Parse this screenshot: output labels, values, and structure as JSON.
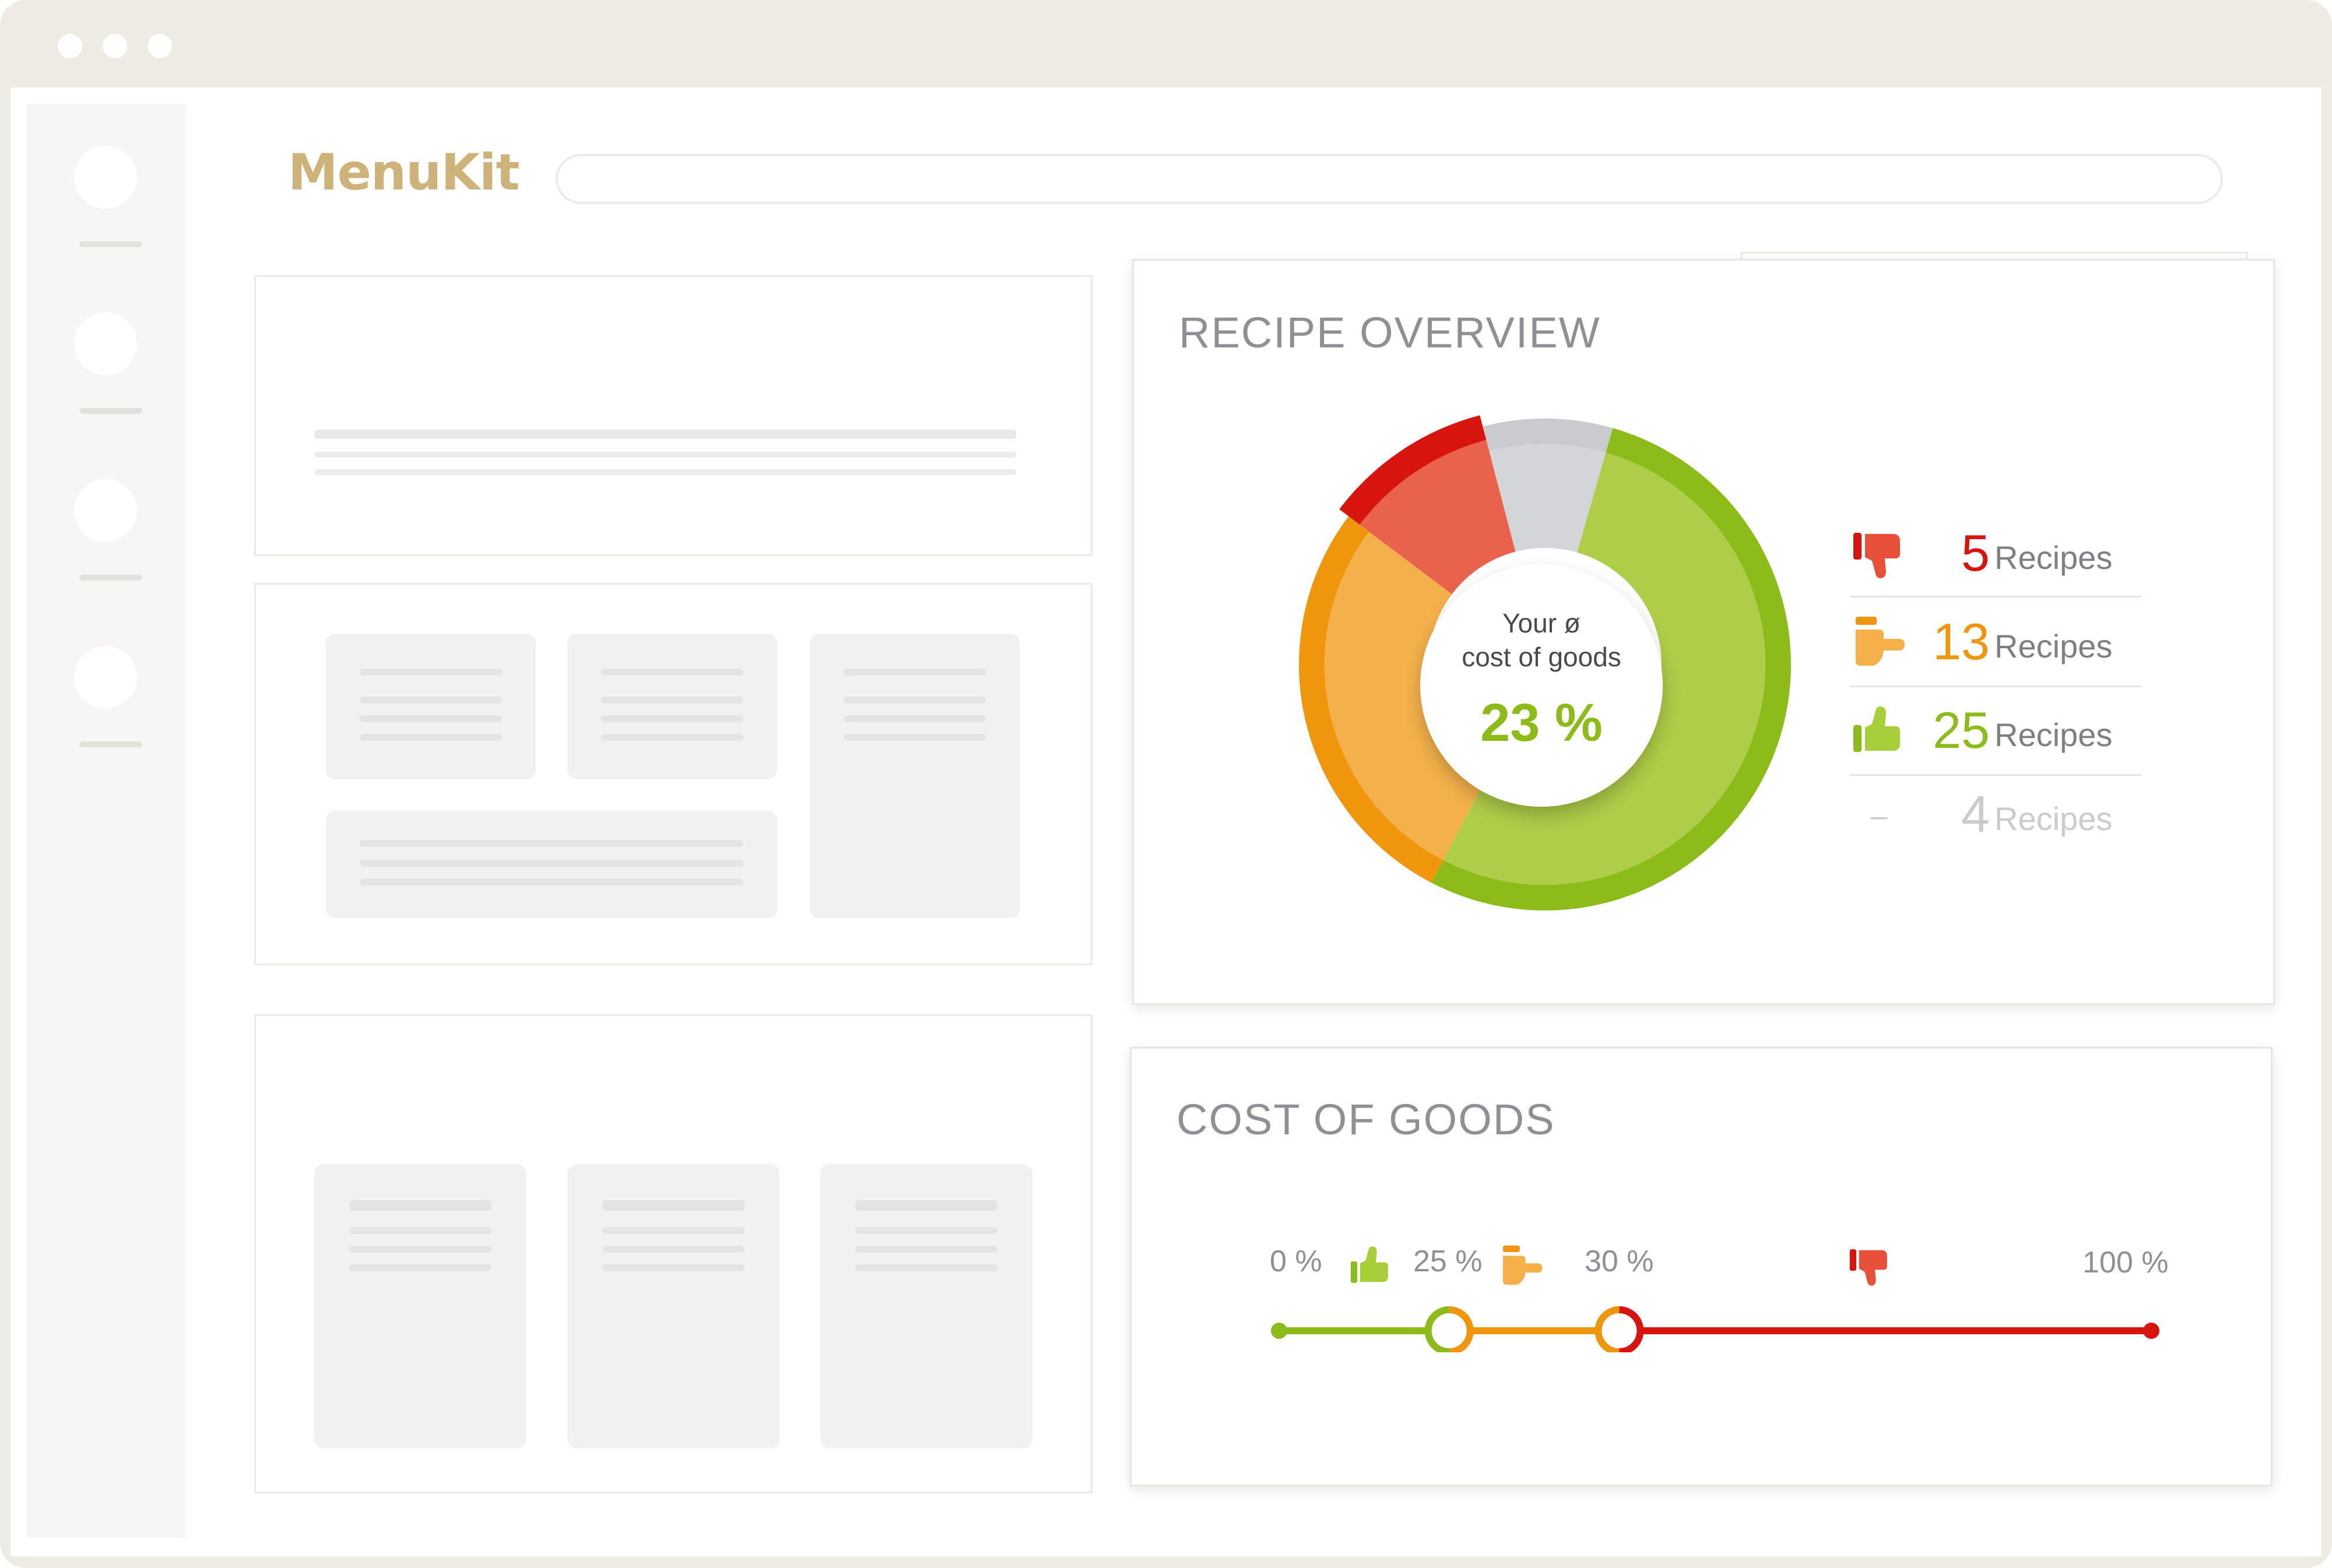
{
  "app": {
    "logo_text": "MenuKit",
    "search": {
      "placeholder": "",
      "value": ""
    }
  },
  "colors": {
    "accent": "#cdb27a",
    "red": "#d7150e",
    "orange": "#f0960d",
    "green": "#8dbb1a",
    "gray": "#c9cbcf"
  },
  "recipe_overview": {
    "title": "RECIPE OVERVIEW",
    "center_label_line1": "Your ø",
    "center_label_line2": "cost of goods",
    "center_value": "23 %",
    "legend": [
      {
        "icon": "thumbs-down-icon",
        "count": "5",
        "label": "Recipes",
        "color": "#d7150e"
      },
      {
        "icon": "thumbs-side-icon",
        "count": "13",
        "label": "Recipes",
        "color": "#f0960d"
      },
      {
        "icon": "thumbs-up-icon",
        "count": "25",
        "label": "Recipes",
        "color": "#8dbb1a"
      },
      {
        "icon": "dash-icon",
        "dash": "–",
        "count": "4",
        "label": "Recipes",
        "color": "#c9cbcf"
      }
    ]
  },
  "chart_data": {
    "type": "pie",
    "title": "RECIPE OVERVIEW",
    "categories": [
      "thumbs up",
      "thumbs side",
      "thumbs down",
      "no rating"
    ],
    "values": [
      25,
      13,
      5,
      4
    ],
    "colors": [
      "#8dbb1a",
      "#f0960d",
      "#d7150e",
      "#c9cbcf"
    ],
    "center_text": "23 %"
  },
  "cost_of_goods": {
    "title": "COST OF GOODS",
    "ticks": [
      "0 %",
      "25 %",
      "30 %",
      "100 %"
    ],
    "thresholds": {
      "green_to": 25,
      "orange_to": 30,
      "max": 100
    }
  }
}
